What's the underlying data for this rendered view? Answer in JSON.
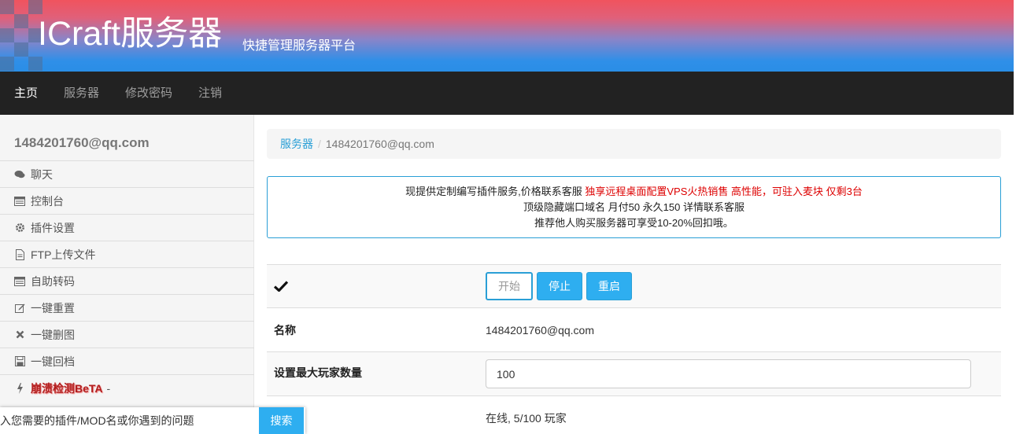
{
  "header": {
    "title": "ICraft服务器",
    "subtitle": "快捷管理服务器平台"
  },
  "nav": {
    "items": [
      {
        "label": "主页",
        "active": true
      },
      {
        "label": "服务器",
        "active": false
      },
      {
        "label": "修改密码",
        "active": false
      },
      {
        "label": "注销",
        "active": false
      }
    ]
  },
  "sidebar": {
    "user_email": "1484201760@qq.com",
    "items": [
      {
        "label": "聊天",
        "icon": "comments-icon"
      },
      {
        "label": "控制台",
        "icon": "console-icon"
      },
      {
        "label": "插件设置",
        "icon": "gear-icon"
      },
      {
        "label": "FTP上传文件",
        "icon": "file-icon"
      },
      {
        "label": "自助转码",
        "icon": "console-icon"
      },
      {
        "label": "一键重置",
        "icon": "edit-icon"
      },
      {
        "label": "一键删图",
        "icon": "close-icon"
      },
      {
        "label": "一键回档",
        "icon": "save-icon"
      },
      {
        "label": "崩溃检测BeTA",
        "icon": "bolt-icon",
        "suffix": "-"
      }
    ]
  },
  "breadcrumb": {
    "link": "服务器",
    "separator": "/",
    "current": "1484201760@qq.com"
  },
  "notice": {
    "line1_black": "现提供定制编写插件服务,价格联系客服 ",
    "line1_red": "独享远程桌面配置VPS火热销售 高性能，可驻入麦块 仅剩3台",
    "line2": "顶级隐藏端口域名 月付50 永久150 详情联系客服",
    "line3": "推荐他人购买服务器可享受10-20%回扣哦。"
  },
  "server": {
    "status_icon": "checkmark-icon",
    "start_label": "开始",
    "stop_label": "停止",
    "restart_label": "重启",
    "name_label": "名称",
    "name_value": "1484201760@qq.com",
    "max_players_label": "设置最大玩家数量",
    "max_players_value": "100",
    "online_value": "在线, 5/100 玩家"
  },
  "search": {
    "placeholder": "入您需要的插件/MOD名或你遇到的问题",
    "button_label": "搜索"
  },
  "colors": {
    "accent": "#2a9fd6",
    "button": "#2eaef0",
    "navbar": "#222222",
    "notice_red": "#dd0000"
  }
}
